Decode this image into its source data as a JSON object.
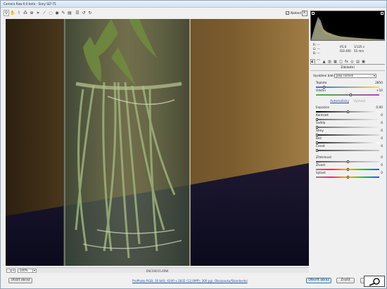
{
  "window": {
    "title": "Camera Raw 6.0 beta - Sony SLT-75"
  },
  "toolbar": {
    "icons": [
      "zoom-icon",
      "hand-icon",
      "white-balance-icon",
      "color-sampler-icon",
      "target-adjust-icon",
      "crop-icon",
      "straighten-icon",
      "spot-removal-icon",
      "red-eye-icon",
      "adjustment-brush-icon",
      "graduated-filter-icon",
      "preferences-icon",
      "rotate-ccw-icon",
      "rotate-cw-icon"
    ],
    "preview_label": "Náhled",
    "preview_checked": "✓"
  },
  "image": {
    "filename": "DSC00015.ARW"
  },
  "zoom": {
    "minus": "-",
    "plus": "+",
    "value": "100%"
  },
  "camera_info": {
    "r_label": "R:",
    "r_value": "---",
    "g_label": "G:",
    "g_value": "---",
    "b_label": "B:",
    "b_value": "---",
    "aperture": "f/5,6",
    "shutter": "1/125 s",
    "iso": "ISO 400",
    "focal": "55 mm"
  },
  "panel": {
    "section_title": "Základní",
    "wb_label": "Vyvážení bílé:",
    "wb_value": "Jako snímek",
    "sliders": {
      "temperature": {
        "label": "Teplota",
        "value": "2850",
        "pos": 0.12
      },
      "tint": {
        "label": "Odstín",
        "value": "+10",
        "pos": 0.55
      },
      "exposure": {
        "label": "Expozice",
        "value": "0,00",
        "pos": 0.5
      },
      "recovery": {
        "label": "Kontrast",
        "value": "0",
        "pos": 0.0
      },
      "fill": {
        "label": "Světla",
        "value": "0",
        "pos": 0.0
      },
      "blacks": {
        "label": "Stíny",
        "value": "0",
        "pos": 0.0
      },
      "brightness": {
        "label": "Bílé",
        "value": "0",
        "pos": 0.0
      },
      "contrast": {
        "label": "Černé",
        "value": "0",
        "pos": 0.0
      },
      "clarity": {
        "label": "Zřetelnost",
        "value": "0",
        "pos": 0.5
      },
      "vibrance": {
        "label": "Živost",
        "value": "0",
        "pos": 0.5
      },
      "saturation": {
        "label": "Sytost",
        "value": "0",
        "pos": 0.5
      }
    },
    "auto_link": "Automaticky",
    "default_link": "Výchozí"
  },
  "footer": {
    "save_button": "Uložit obraz",
    "workflow_link": "ProPhoto RGB; 16 bitů; 4240 x 2832 (12,0MP); 300 ppi; Obrazovka/Standardní",
    "open_button": "Otevřít obraz",
    "cancel_button": "Zrušit",
    "done_button": "Hotovo"
  }
}
